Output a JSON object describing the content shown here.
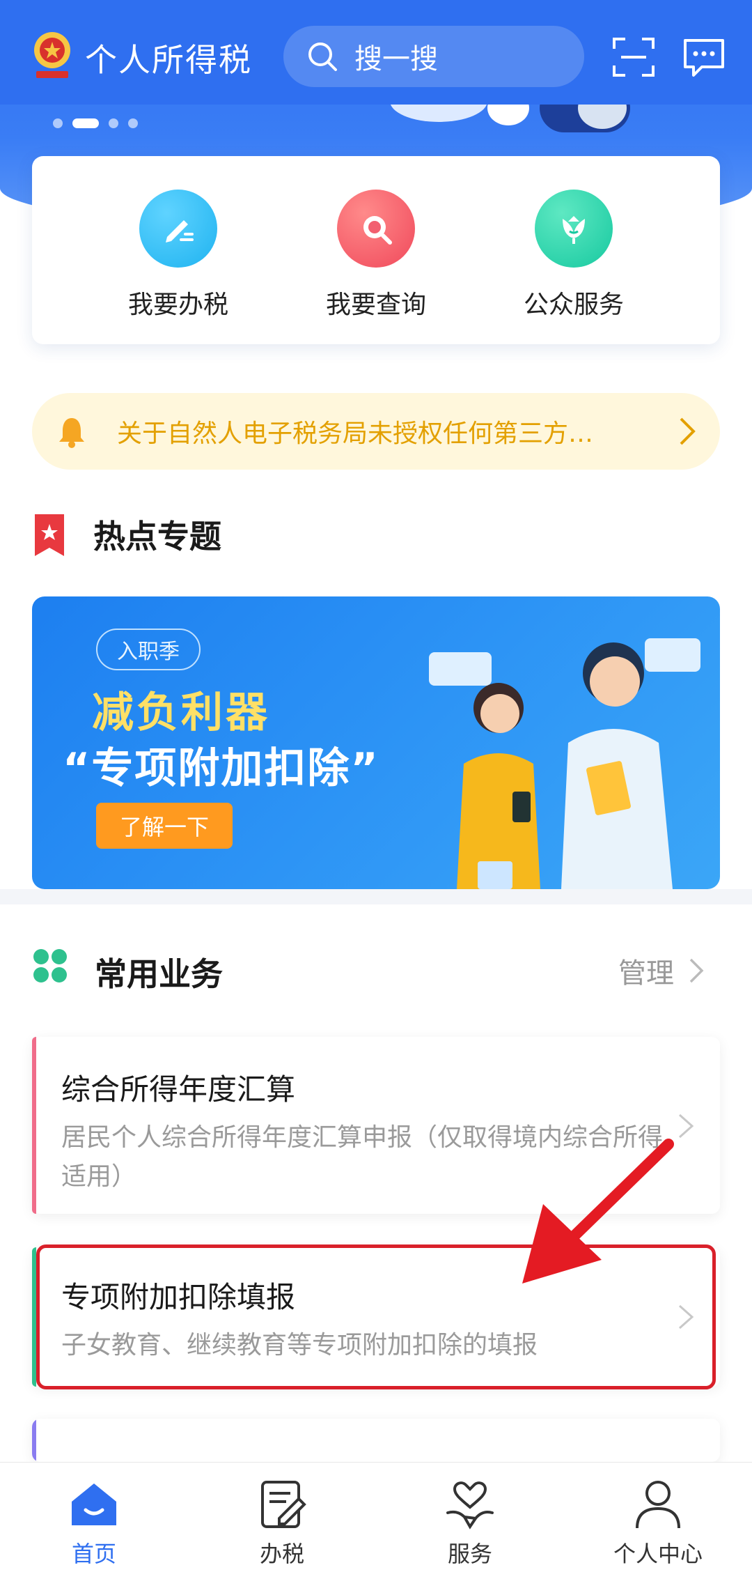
{
  "header": {
    "app_title": "个人所得税",
    "search_placeholder": "搜一搜"
  },
  "carousel": {
    "count": 4,
    "active_index": 1
  },
  "quick_entries": [
    {
      "label": "我要办税",
      "icon": "pencil-icon",
      "color": "#1fb3f0"
    },
    {
      "label": "我要查询",
      "icon": "magnifier-icon",
      "color": "#f0495b"
    },
    {
      "label": "公众服务",
      "icon": "tulip-icon",
      "color": "#17c9a0"
    }
  ],
  "notice": {
    "text": "关于自然人电子税务局未授权任何第三方…"
  },
  "hot_topics": {
    "title": "热点专题",
    "banner": {
      "tag": "入职季",
      "headline": "减负利器",
      "subheadline": "“专项附加扣除”",
      "cta": "了解一下"
    }
  },
  "common_services": {
    "title": "常用业务",
    "manage_label": "管理",
    "items": [
      {
        "title": "综合所得年度汇算",
        "desc": "居民个人综合所得年度汇算申报（仅取得境内综合所得适用）",
        "accent": "#f06d8a"
      },
      {
        "title": "专项附加扣除填报",
        "desc": "子女教育、继续教育等专项附加扣除的填报",
        "accent": "#2ec18e"
      }
    ]
  },
  "bottom_nav": [
    {
      "label": "首页",
      "icon": "home-icon",
      "active": true
    },
    {
      "label": "办税",
      "icon": "document-edit-icon",
      "active": false
    },
    {
      "label": "服务",
      "icon": "heart-hand-icon",
      "active": false
    },
    {
      "label": "个人中心",
      "icon": "user-icon",
      "active": false
    }
  ],
  "colors": {
    "brand": "#2f6ff0",
    "highlight": "#d9202a",
    "notice_text": "#e3a000"
  }
}
